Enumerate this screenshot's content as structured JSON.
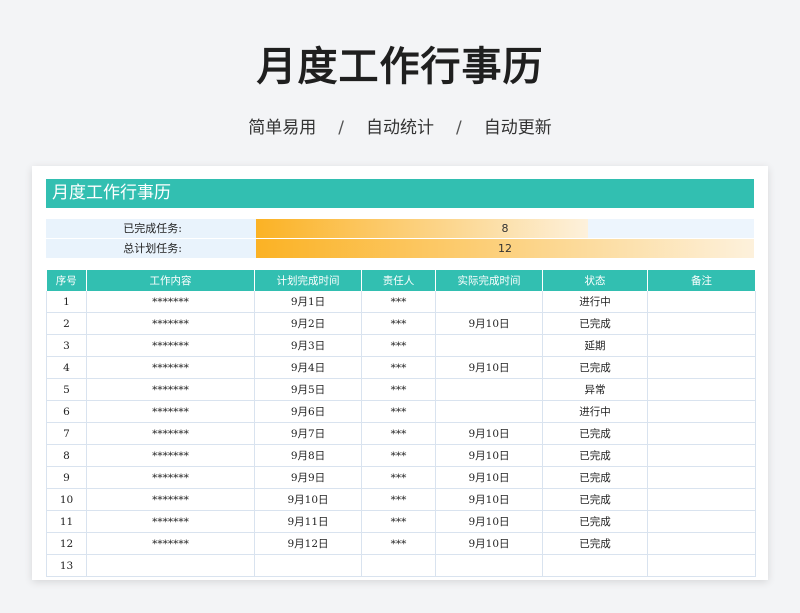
{
  "hero": {
    "title": "月度工作行事历",
    "tags": [
      "简单易用",
      "自动统计",
      "自动更新"
    ],
    "separator": "/"
  },
  "sheet": {
    "banner": "月度工作行事历",
    "stats": [
      {
        "label": "已完成任务:",
        "value": "8",
        "fill_fraction": 0.667
      },
      {
        "label": "总计划任务:",
        "value": "12",
        "fill_fraction": 1.0
      }
    ],
    "columns": [
      "序号",
      "工作内容",
      "计划完成时间",
      "责任人",
      "实际完成时间",
      "状态",
      "备注"
    ],
    "rows": [
      {
        "no": "1",
        "content": "*******",
        "plan": "9月1日",
        "owner": "***",
        "actual": "",
        "status": "进行中",
        "status_type": "inprogress",
        "note": ""
      },
      {
        "no": "2",
        "content": "*******",
        "plan": "9月2日",
        "owner": "***",
        "actual": "9月10日",
        "status": "已完成",
        "status_type": "done",
        "note": ""
      },
      {
        "no": "3",
        "content": "*******",
        "plan": "9月3日",
        "owner": "***",
        "actual": "",
        "status": "延期",
        "status_type": "delay",
        "note": ""
      },
      {
        "no": "4",
        "content": "*******",
        "plan": "9月4日",
        "owner": "***",
        "actual": "9月10日",
        "status": "已完成",
        "status_type": "done",
        "note": ""
      },
      {
        "no": "5",
        "content": "*******",
        "plan": "9月5日",
        "owner": "***",
        "actual": "",
        "status": "异常",
        "status_type": "error",
        "note": ""
      },
      {
        "no": "6",
        "content": "*******",
        "plan": "9月6日",
        "owner": "***",
        "actual": "",
        "status": "进行中",
        "status_type": "inprogress",
        "note": ""
      },
      {
        "no": "7",
        "content": "*******",
        "plan": "9月7日",
        "owner": "***",
        "actual": "9月10日",
        "status": "已完成",
        "status_type": "done",
        "note": ""
      },
      {
        "no": "8",
        "content": "*******",
        "plan": "9月8日",
        "owner": "***",
        "actual": "9月10日",
        "status": "已完成",
        "status_type": "done",
        "note": ""
      },
      {
        "no": "9",
        "content": "*******",
        "plan": "9月9日",
        "owner": "***",
        "actual": "9月10日",
        "status": "已完成",
        "status_type": "done",
        "note": ""
      },
      {
        "no": "10",
        "content": "*******",
        "plan": "9月10日",
        "owner": "***",
        "actual": "9月10日",
        "status": "已完成",
        "status_type": "done",
        "note": ""
      },
      {
        "no": "11",
        "content": "*******",
        "plan": "9月11日",
        "owner": "***",
        "actual": "9月10日",
        "status": "已完成",
        "status_type": "done",
        "note": ""
      },
      {
        "no": "12",
        "content": "*******",
        "plan": "9月12日",
        "owner": "***",
        "actual": "9月10日",
        "status": "已完成",
        "status_type": "done",
        "note": ""
      },
      {
        "no": "13",
        "content": "",
        "plan": "",
        "owner": "",
        "actual": "",
        "status": "",
        "status_type": "",
        "note": ""
      }
    ]
  }
}
